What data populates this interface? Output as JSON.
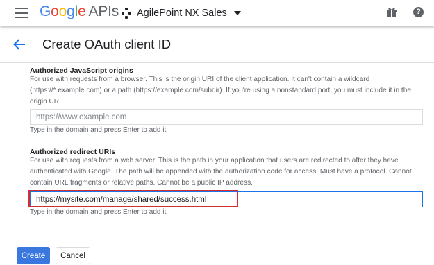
{
  "header": {
    "logo": {
      "letters": [
        "G",
        "o",
        "o",
        "g",
        "l",
        "e"
      ],
      "suffix": "APIs"
    },
    "project_name": "AgilePoint NX Sales",
    "icons": [
      "menu-icon",
      "project-icon",
      "caret-down-icon",
      "gift-icon",
      "help-icon"
    ],
    "help_glyph": "?"
  },
  "page": {
    "title": "Create OAuth client ID",
    "back_icon": "arrow-back-icon"
  },
  "js_origins": {
    "title": "Authorized JavaScript origins",
    "description": "For use with requests from a browser. This is the origin URI of the client application. It can't contain a wildcard (https://*.example.com) or a path (https://example.com/subdir). If you're using a nonstandard port, you must include it in the origin URI.",
    "placeholder": "https://www.example.com",
    "value": "",
    "hint": "Type in the domain and press Enter to add it"
  },
  "redirect_uris": {
    "title": "Authorized redirect URIs",
    "description": "For use with requests from a web server. This is the path in your application that users are redirected to after they have authenticated with Google. The path will be appended with the authorization code for access. Must have a protocol. Cannot contain URL fragments or relative paths. Cannot be a public IP address.",
    "value": "https://mysite.com/manage/shared/success.html",
    "hint": "Type in the domain and press Enter to add it"
  },
  "actions": {
    "create_label": "Create",
    "cancel_label": "Cancel"
  },
  "colors": {
    "primary": "#3a78e0",
    "highlight": "#d32f2f",
    "logo_blue": "#4285f4",
    "logo_red": "#ea4335",
    "logo_yellow": "#fbbc05",
    "logo_green": "#34a853"
  }
}
